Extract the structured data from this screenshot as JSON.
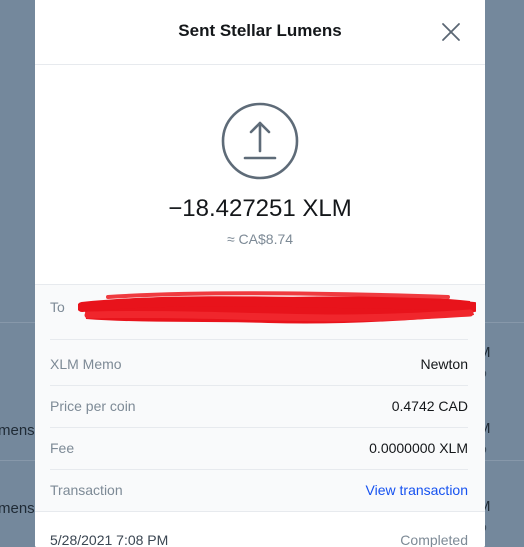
{
  "modal": {
    "title": "Sent Stellar Lumens",
    "close_icon": "close-icon",
    "icon": "upload-arrow-icon",
    "amount": "−18.427251 XLM",
    "fiat_amount": "≈ CA$8.74"
  },
  "details": {
    "to_label": "To",
    "memo_label": "XLM Memo",
    "memo_value": "Newton",
    "price_label": "Price per coin",
    "price_value": "0.4742 CAD",
    "fee_label": "Fee",
    "fee_value": "0.0000000 XLM",
    "transaction_label": "Transaction",
    "transaction_link": "View transaction"
  },
  "footer": {
    "date": "5/28/2021 7:08 PM",
    "status": "Completed"
  },
  "background": {
    "row_fragment": "mens",
    "right_fragment": "M"
  },
  "colors": {
    "accent": "#1652f0",
    "backdrop": "#74889c",
    "redaction": "#e8131b"
  }
}
